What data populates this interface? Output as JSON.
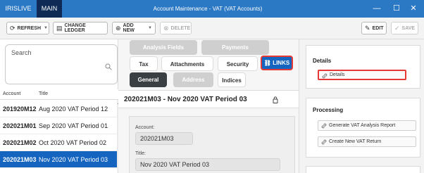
{
  "window": {
    "app_tabs": [
      "IRISLIVE",
      "MAIN"
    ],
    "title": "Account Maintenance - VAT (VAT Accounts)",
    "controls": {
      "minimize": "—",
      "maximize": "☐",
      "close": "✕"
    }
  },
  "toolbar": {
    "refresh": "REFRESH",
    "change_ledger": "CHANGE LEDGER",
    "add_new": "ADD NEW",
    "delete": "DELETE",
    "edit": "EDIT",
    "save": "SAVE"
  },
  "search": {
    "placeholder": "Search"
  },
  "list": {
    "columns": [
      "Account",
      "Title"
    ],
    "rows": [
      {
        "account": "201920M12",
        "title": "Aug 2020 VAT Period 12"
      },
      {
        "account": "202021M01",
        "title": "Sep 2020 VAT Period 01"
      },
      {
        "account": "202021M02",
        "title": "Oct 2020 VAT Period 02"
      },
      {
        "account": "202021M03",
        "title": "Nov 2020 VAT Period 03"
      }
    ],
    "selected_index": 3
  },
  "tabs": {
    "analysis_fields": "Analysis Fields",
    "payments": "Payments",
    "tax": "Tax",
    "attachments": "Attachments",
    "security": "Security",
    "links": "LINKS",
    "general": "General",
    "address": "Address",
    "indices": "Indices"
  },
  "record": {
    "header": "202021M03 - Nov 2020 VAT Period 03",
    "account_label": "Account:",
    "account_value": "202021M03",
    "title_label": "Title:",
    "title_value": "Nov 2020 VAT Period 03"
  },
  "right_panel": {
    "details_title": "Details",
    "details_link": "Details",
    "processing_title": "Processing",
    "generate_link": "Generate VAT Analysis Report",
    "create_link": "Create New VAT Return"
  },
  "colors": {
    "title_bar": "#2b78c4",
    "active_app_tab": "#0e2a55",
    "selected_row": "#1565c0",
    "highlight_border": "#e53935",
    "general_tab": "#3a3f44"
  }
}
